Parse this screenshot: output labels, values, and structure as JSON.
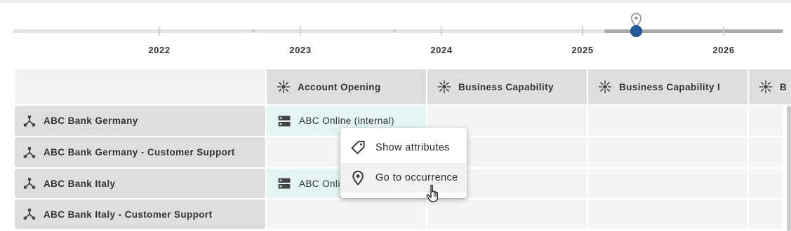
{
  "timeline": {
    "years": [
      "2022",
      "2023",
      "2024",
      "2025",
      "2026"
    ],
    "selected_start_year": "2025",
    "handle_icon": "map-pin-icon"
  },
  "matrix": {
    "columns": [
      {
        "label": "Account Opening",
        "icon": "capability-icon"
      },
      {
        "label": "Business Capability",
        "icon": "capability-icon"
      },
      {
        "label": "Business Capability I",
        "icon": "capability-icon"
      },
      {
        "label": "B",
        "icon": "capability-icon"
      }
    ],
    "rows": [
      {
        "label": "ABC Bank Germany",
        "icon": "organization-icon",
        "cells": [
          "ABC Online (internal)",
          "",
          "",
          ""
        ]
      },
      {
        "label": "ABC Bank Germany - Customer Support",
        "icon": "organization-icon",
        "cells": [
          "",
          "",
          "",
          ""
        ]
      },
      {
        "label": "ABC Bank Italy",
        "icon": "organization-icon",
        "cells": [
          "ABC Online (internal)",
          "",
          "",
          ""
        ]
      },
      {
        "label": "ABC Bank Italy - Customer Support",
        "icon": "organization-icon",
        "cells": [
          "",
          "",
          "",
          ""
        ]
      }
    ]
  },
  "context_menu": {
    "items": [
      {
        "label": "Show attributes",
        "icon": "tag-icon"
      },
      {
        "label": "Go to occurrence",
        "icon": "map-pin-icon"
      }
    ],
    "hovered_item": "Go to occurrence"
  },
  "colors": {
    "timeline_handle": "#1f5a9a",
    "occurrence_cell": "#e3f4f3",
    "header_bg": "#dedede"
  }
}
